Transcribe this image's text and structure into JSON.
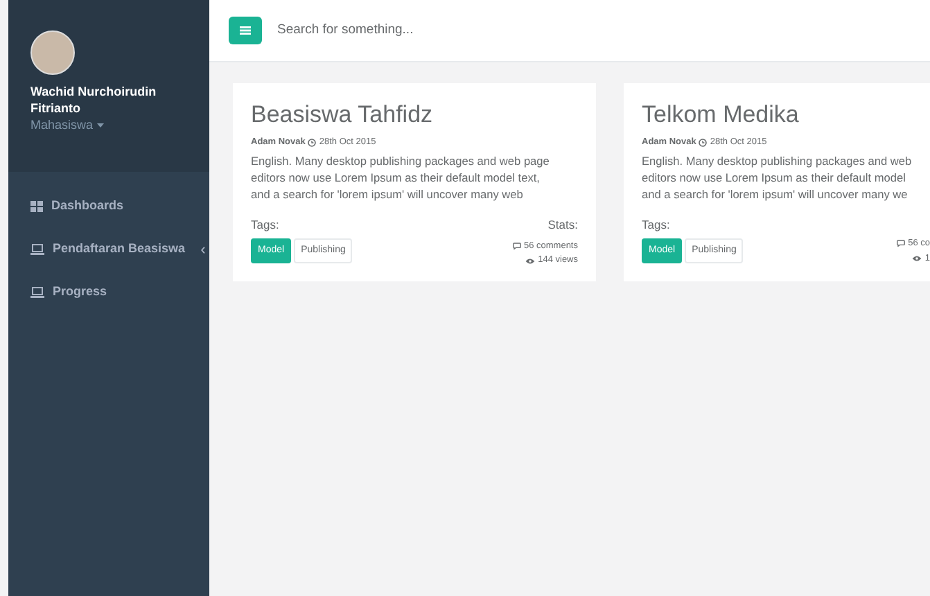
{
  "sidebar": {
    "profile": {
      "name": "Wachid Nurchoirudin Fitrianto",
      "role": "Mahasiswa"
    },
    "items": [
      {
        "label": "Dashboards",
        "kind": "grid",
        "has_submenu": false
      },
      {
        "label": "Pendaftaran Beasiswa",
        "kind": "laptop",
        "has_submenu": true
      },
      {
        "label": "Progress",
        "kind": "laptop",
        "has_submenu": false
      }
    ]
  },
  "topbar": {
    "search": {
      "placeholder": "Search for something..."
    }
  },
  "cards": [
    {
      "title": "Beasiswa Tahfidz",
      "author": "Adam Novak",
      "date": "28th Oct 2015",
      "lines": [
        "English. Many desktop publishing packages and web page",
        "editors now use Lorem Ipsum as their default model text,",
        "and a search for 'lorem ipsum' will uncover many web"
      ],
      "tags_label": "Tags:",
      "tags": [
        {
          "label": "Model",
          "selected": true
        },
        {
          "label": "Publishing",
          "selected": false
        }
      ],
      "stats_label": "Stats:",
      "comments": "56 comments",
      "views": "144 views"
    },
    {
      "title": "Telkom Medika",
      "author": "Adam Novak",
      "date": "28th Oct 2015",
      "lines": [
        "English. Many desktop publishing packages and web",
        "editors now use Lorem Ipsum as their default model",
        "and a search for 'lorem ipsum' will uncover many we"
      ],
      "tags_label": "Tags:",
      "tags": [
        {
          "label": "Model",
          "selected": true
        },
        {
          "label": "Publishing",
          "selected": false
        }
      ],
      "comments": "56 co",
      "views": "1"
    }
  ]
}
